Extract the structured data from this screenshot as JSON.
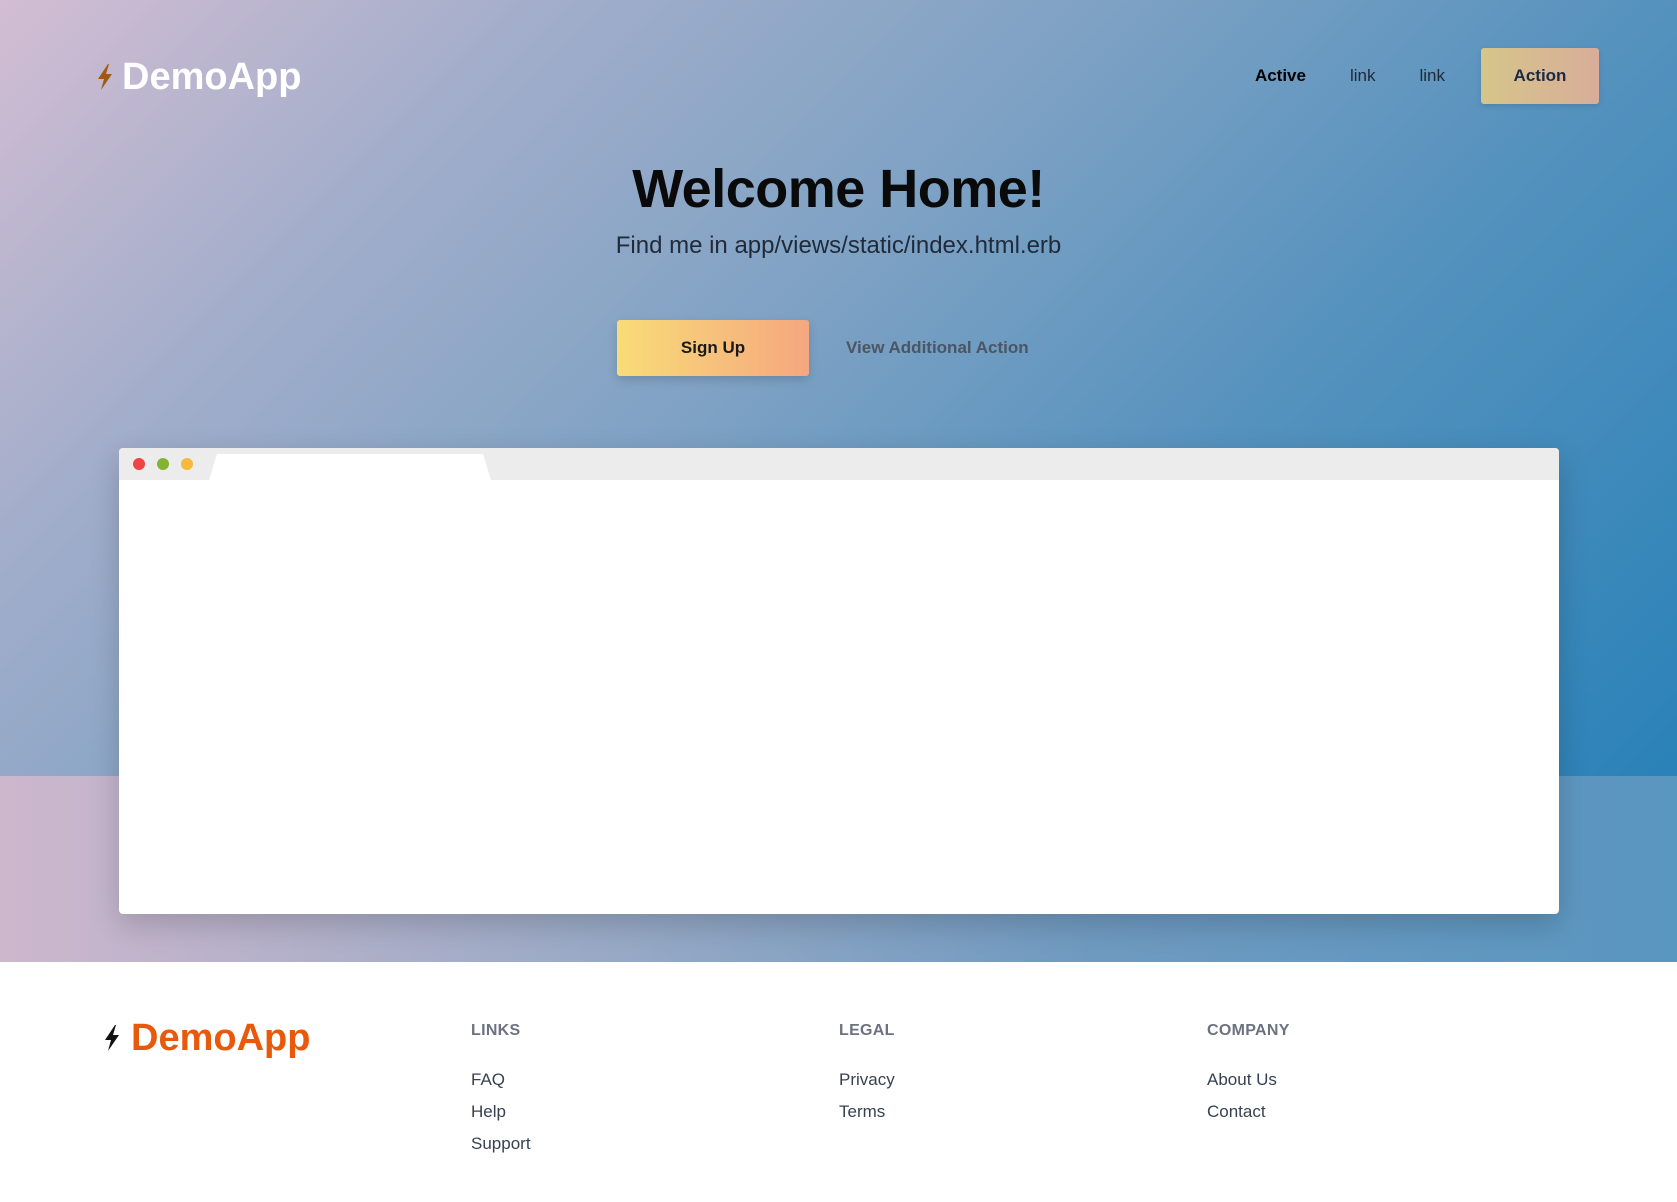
{
  "brand": {
    "name": "DemoApp",
    "icon": "bolt-icon"
  },
  "nav": {
    "links": [
      {
        "label": "Active",
        "active": true
      },
      {
        "label": "link",
        "active": false
      },
      {
        "label": "link",
        "active": false
      }
    ],
    "action_label": "Action"
  },
  "hero": {
    "title": "Welcome Home!",
    "subtitle": "Find me in app/views/static/index.html.erb",
    "primary_label": "Sign Up",
    "secondary_label": "View Additional Action"
  },
  "browser_mockup": {
    "dots": [
      "#ef4444",
      "#84b231",
      "#f6b93b"
    ]
  },
  "footer": {
    "brand_name": "DemoApp",
    "columns": [
      {
        "heading": "LINKS",
        "items": [
          "FAQ",
          "Help",
          "Support"
        ]
      },
      {
        "heading": "LEGAL",
        "items": [
          "Privacy",
          "Terms"
        ]
      },
      {
        "heading": "COMPANY",
        "items": [
          "About Us",
          "Contact"
        ]
      }
    ]
  },
  "colors": {
    "accent": "#e8590c",
    "button_gradient_start": "#f8dc78",
    "button_gradient_end": "#f5a77f"
  }
}
